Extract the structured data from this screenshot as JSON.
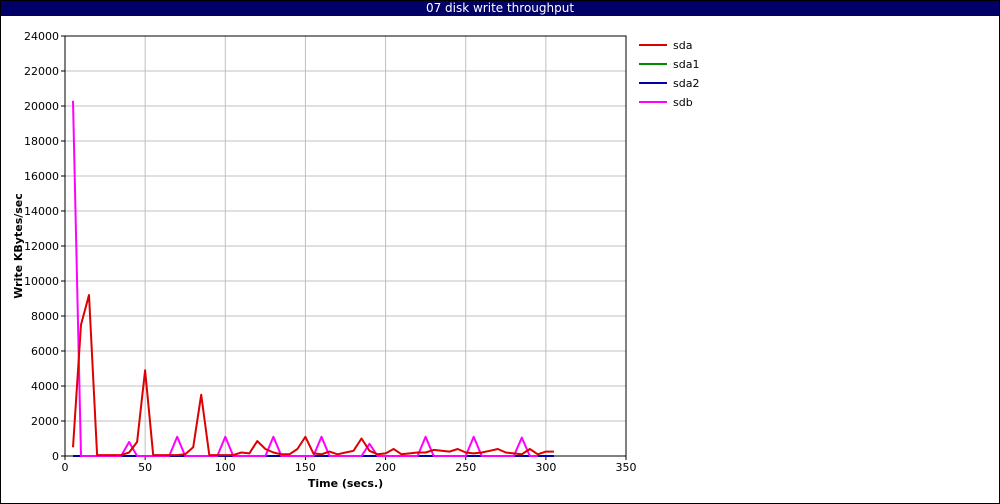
{
  "chart_data": {
    "type": "line",
    "title": "07 disk write throughput",
    "xlabel": "Time (secs.)",
    "ylabel": "Write KBytes/sec",
    "xlim": [
      0,
      350
    ],
    "ylim": [
      0,
      24000
    ],
    "xticks": [
      0,
      50,
      100,
      150,
      200,
      250,
      300,
      350
    ],
    "yticks": [
      0,
      2000,
      4000,
      6000,
      8000,
      10000,
      12000,
      14000,
      16000,
      18000,
      20000,
      22000,
      24000
    ],
    "grid": true,
    "legend_position": "top-right",
    "series": [
      {
        "name": "sda",
        "color": "#dd0000",
        "x": [
          5,
          10,
          15,
          20,
          25,
          30,
          35,
          40,
          45,
          50,
          55,
          60,
          65,
          70,
          75,
          80,
          85,
          90,
          95,
          100,
          105,
          110,
          115,
          120,
          125,
          130,
          135,
          140,
          145,
          150,
          155,
          160,
          165,
          170,
          175,
          180,
          185,
          190,
          195,
          200,
          205,
          210,
          215,
          220,
          225,
          230,
          235,
          240,
          245,
          250,
          255,
          260,
          265,
          270,
          275,
          280,
          285,
          290,
          295,
          300,
          305
        ],
        "y": [
          500,
          7500,
          9200,
          50,
          50,
          50,
          50,
          200,
          800,
          4900,
          50,
          50,
          50,
          50,
          100,
          500,
          3500,
          50,
          50,
          50,
          50,
          200,
          150,
          850,
          400,
          200,
          100,
          100,
          400,
          1100,
          150,
          100,
          250,
          100,
          200,
          300,
          1000,
          300,
          100,
          150,
          400,
          100,
          150,
          200,
          200,
          350,
          300,
          250,
          400,
          200,
          150,
          200,
          300,
          400,
          200,
          150,
          100,
          400,
          100,
          250,
          250
        ]
      },
      {
        "name": "sda1",
        "color": "#008800",
        "x": [
          5,
          305
        ],
        "y": [
          0,
          0
        ]
      },
      {
        "name": "sda2",
        "color": "#0000aa",
        "x": [
          5,
          305
        ],
        "y": [
          0,
          0
        ]
      },
      {
        "name": "sdb",
        "color": "#ff00ff",
        "x": [
          5,
          10,
          15,
          20,
          25,
          30,
          35,
          40,
          45,
          50,
          55,
          60,
          65,
          70,
          75,
          80,
          85,
          90,
          95,
          100,
          105,
          110,
          115,
          120,
          125,
          130,
          135,
          140,
          145,
          150,
          155,
          160,
          165,
          170,
          175,
          180,
          185,
          190,
          195,
          200,
          205,
          210,
          215,
          220,
          225,
          230,
          235,
          240,
          245,
          250,
          255,
          260,
          265,
          270,
          275,
          280,
          285,
          290,
          295
        ],
        "y": [
          20300,
          0,
          0,
          0,
          0,
          0,
          0,
          800,
          0,
          0,
          0,
          0,
          0,
          1100,
          0,
          0,
          0,
          0,
          0,
          1100,
          0,
          0,
          0,
          0,
          0,
          1100,
          0,
          0,
          0,
          0,
          0,
          1100,
          0,
          0,
          0,
          0,
          0,
          700,
          0,
          0,
          0,
          0,
          0,
          0,
          1100,
          0,
          0,
          0,
          0,
          0,
          1100,
          0,
          0,
          0,
          0,
          0,
          1050,
          0,
          0
        ]
      }
    ]
  }
}
